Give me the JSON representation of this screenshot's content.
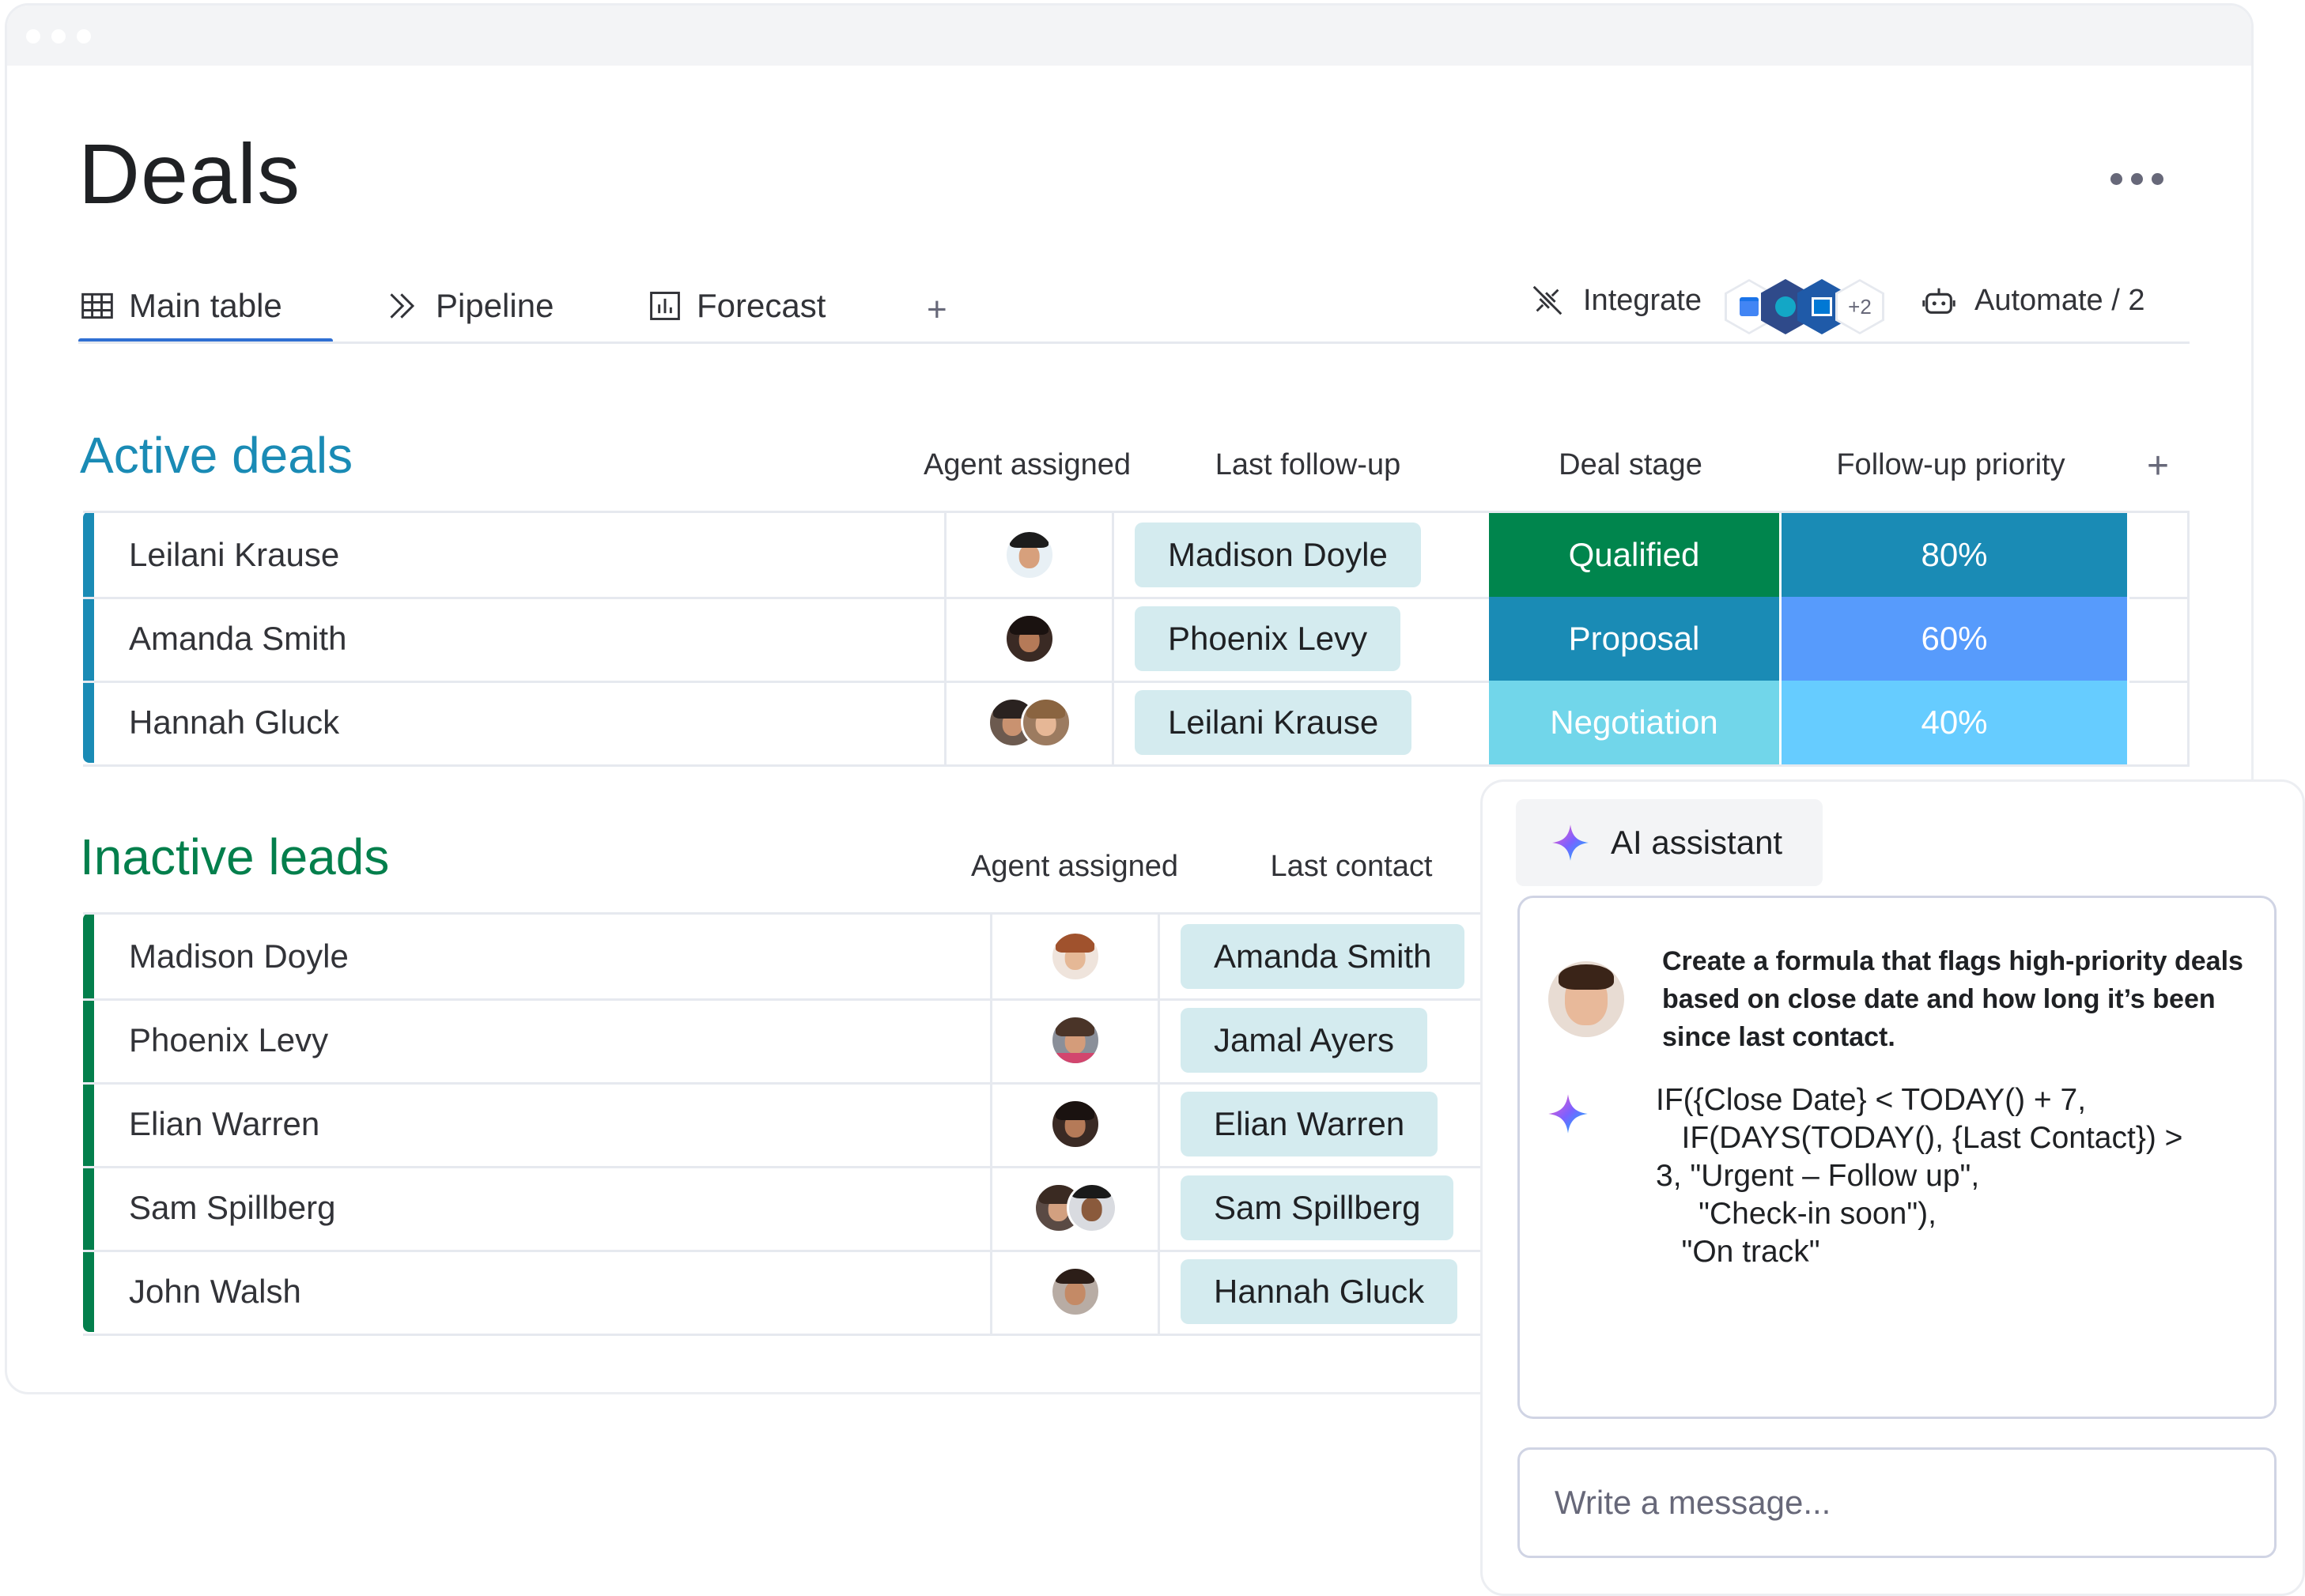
{
  "page": {
    "title": "Deals"
  },
  "tabs": [
    {
      "label": "Main table",
      "icon": "table-icon",
      "active": true
    },
    {
      "label": "Pipeline",
      "icon": "pipeline-icon"
    },
    {
      "label": "Forecast",
      "icon": "chart-icon"
    }
  ],
  "toolbar": {
    "add_tab": "+",
    "integrate_label": "Integrate",
    "integrations_more": "+2",
    "automate_label": "Automate / 2"
  },
  "active_deals": {
    "title": "Active deals",
    "color": "#1a8bb5",
    "columns": [
      "Agent assigned",
      "Last follow-up",
      "Deal stage",
      "Follow-up priority"
    ],
    "add_column": "+",
    "rows": [
      {
        "name": "Leilani Krause",
        "follow_up": "Madison Doyle",
        "stage": "Qualified",
        "stage_color": "#00854d",
        "priority": "80%",
        "priority_color": "#1a8bb5"
      },
      {
        "name": "Amanda Smith",
        "follow_up": "Phoenix Levy",
        "stage": "Proposal",
        "stage_color": "#1a8bb5",
        "priority": "60%",
        "priority_color": "#579bfc"
      },
      {
        "name": "Hannah Gluck",
        "follow_up": "Leilani Krause",
        "stage": "Negotiation",
        "stage_color": "#71d6ea",
        "priority": "40%",
        "priority_color": "#66ccff"
      }
    ]
  },
  "inactive_leads": {
    "title": "Inactive leads",
    "color": "#037f4c",
    "columns": [
      "Agent assigned",
      "Last contact"
    ],
    "rows": [
      {
        "name": "Madison Doyle",
        "contact": "Amanda Smith"
      },
      {
        "name": "Phoenix Levy",
        "contact": "Jamal Ayers"
      },
      {
        "name": "Elian Warren",
        "contact": "Elian Warren"
      },
      {
        "name": "Sam Spillberg",
        "contact": "Sam Spillberg"
      },
      {
        "name": "John Walsh",
        "contact": "Hannah Gluck"
      }
    ]
  },
  "ai_assistant": {
    "button_label": "AI assistant",
    "prompt": "Create a formula that flags high-priority deals based on close date and how long it’s been since last contact.",
    "formula": "IF({Close Date} < TODAY() + 7,\n   IF(DAYS(TODAY(), {Last Contact}) >\n3, \"Urgent – Follow up\",\n     \"Check-in soon\"),\n   \"On track\"",
    "input_placeholder": "Write a message..."
  }
}
